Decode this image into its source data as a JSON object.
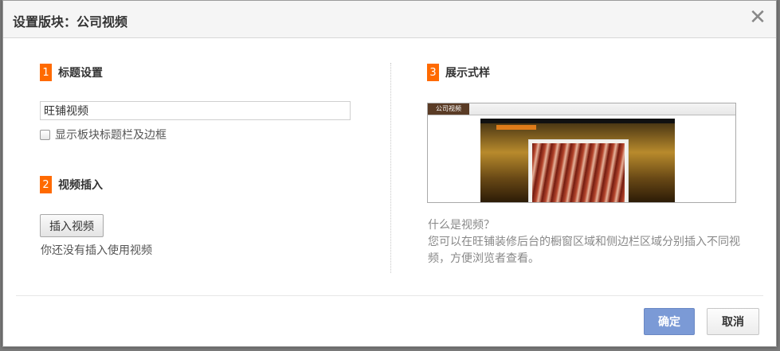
{
  "dialog": {
    "title_prefix": "设置版块：",
    "title_module": "公司视频",
    "close_glyph": "✕"
  },
  "section1": {
    "number": "1",
    "label": "标题设置",
    "title_value": "旺铺视频",
    "show_border_label": "显示板块标题栏及边框",
    "show_border_checked": false
  },
  "section2": {
    "number": "2",
    "label": "视频插入",
    "insert_button": "插入视频",
    "status_text": "你还没有插入使用视频"
  },
  "section3": {
    "number": "3",
    "label": "展示式样",
    "preview_tab": "公司视频",
    "info_question": "什么是视频？",
    "info_answer": "您可以在旺铺装修后台的橱窗区域和侧边栏区域分别插入不同视频，方便浏览者查看。"
  },
  "footer": {
    "confirm": "确定",
    "cancel": "取消"
  },
  "colors": {
    "accent": "#ff6a00",
    "primary_button": "#7b9ad6"
  }
}
